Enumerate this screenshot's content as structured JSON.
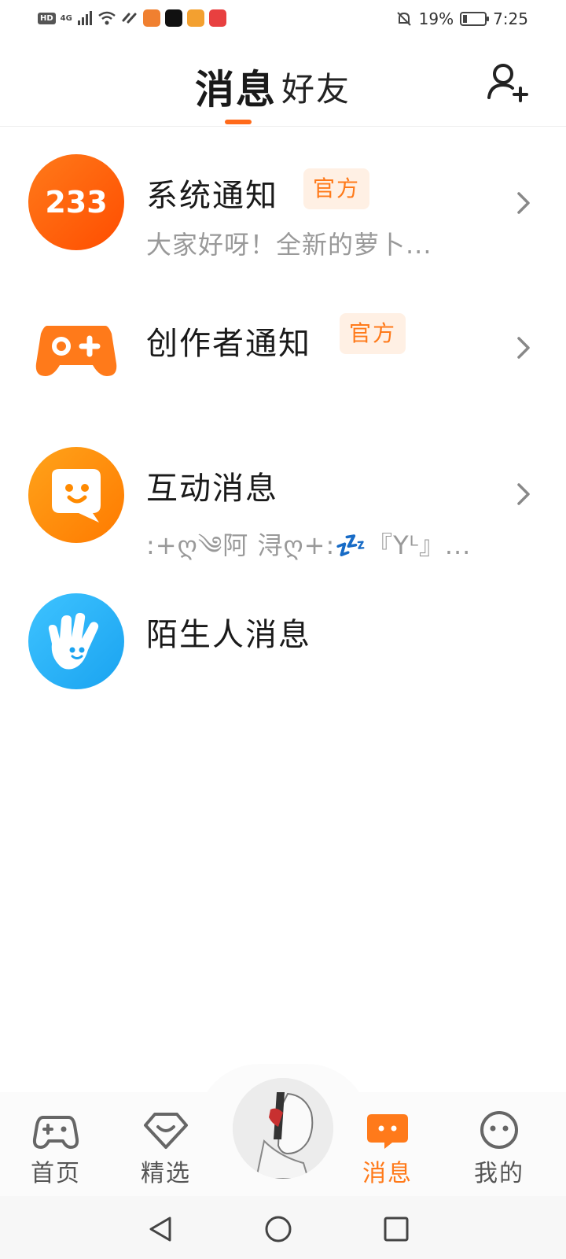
{
  "status_bar": {
    "left_badge": "HD",
    "network": "4G",
    "battery_percent": "19%",
    "battery_level": 0.19,
    "time": "7:25"
  },
  "header": {
    "tabs": [
      {
        "label": "消息",
        "active": true
      },
      {
        "label": "好友",
        "active": false
      }
    ],
    "add_friend_icon": "add-user-icon"
  },
  "messages": [
    {
      "title": "系统通知",
      "badge": "官方",
      "preview": "大家好呀！全新的萝卜...",
      "icon": "233-logo",
      "has_chevron": true
    },
    {
      "title": "创作者通知",
      "badge": "官方",
      "preview": "",
      "icon": "gamepad-icon",
      "has_chevron": true
    },
    {
      "title": "互动消息",
      "badge": "",
      "preview": ":+ღ༄阿 浔ღ+:💤『Yᴸ』...",
      "icon": "smile-bubble-icon",
      "has_chevron": true
    },
    {
      "title": "陌生人消息",
      "badge": "",
      "preview": "",
      "icon": "wave-hand-icon",
      "has_chevron": false
    }
  ],
  "bottom_nav": [
    {
      "label": "首页",
      "icon": "gamepad-icon",
      "active": false
    },
    {
      "label": "精选",
      "icon": "heart-diamond-icon",
      "active": false
    },
    {
      "label": "消息",
      "icon": "message-bubble-icon",
      "active": true
    },
    {
      "label": "我的",
      "icon": "face-icon",
      "active": false
    }
  ],
  "colors": {
    "accent": "#ff7a1a",
    "badge_bg": "#fff0e4",
    "text_primary": "#1a1a1a",
    "text_secondary": "#999999"
  }
}
